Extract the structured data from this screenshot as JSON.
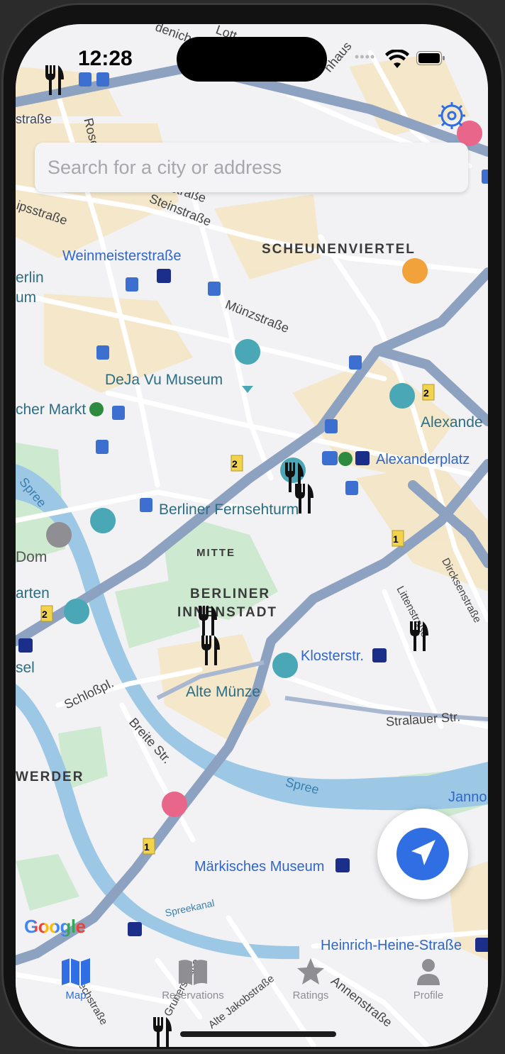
{
  "status": {
    "time": "12:28",
    "dots": "••••"
  },
  "search": {
    "placeholder": "Search for a city or address"
  },
  "map": {
    "districts": [
      "SCHEUNENVIERTEL",
      "MITTE",
      "BERLINER",
      "INNENSTADT",
      "WERDER"
    ],
    "stations": [
      "Weinmeisterstraße",
      "Alexanderplatz",
      "Klosterstr.",
      "Märkisches Museum",
      "Heinrich-Heine-Straße",
      "Janno"
    ],
    "pois": [
      "DeJa Vu Museum",
      "Alexande",
      "Berliner Fernsehturm",
      "Alte Münze",
      "cher Markt",
      "Dom",
      "arten",
      "sel",
      "erlin",
      "um"
    ],
    "streets": [
      "Münzstraße",
      "Steinstraße",
      "Schloßpl.",
      "Breite Str.",
      "Stralauer Str.",
      "Spree",
      "Spree",
      "Dircksenstraße",
      "Littenstraße",
      "Spreekanal",
      "Grunerstraße",
      "Alte Jakobstraße",
      "Annenstraße",
      "Bechstraße",
      "straße",
      "ipsstraße",
      "straße",
      "Rosent",
      "Lott",
      "denich",
      "nhaus"
    ],
    "road_numbers": [
      "2",
      "2",
      "1",
      "2",
      "1"
    ],
    "google_logo": "Google",
    "colors": {
      "water": "#9cc8e6",
      "park": "#bfe3c4",
      "major_road": "#8da1c1",
      "block": "#f4e5c5",
      "accent": "#2f6fe3"
    }
  },
  "markers": {
    "icon": "fork-knife-icon"
  },
  "tabs": [
    {
      "label": "Map",
      "icon": "map-icon"
    },
    {
      "label": "Reservations",
      "icon": "book-icon"
    },
    {
      "label": "Ratings",
      "icon": "star-icon"
    },
    {
      "label": "Profile",
      "icon": "person-icon"
    }
  ]
}
